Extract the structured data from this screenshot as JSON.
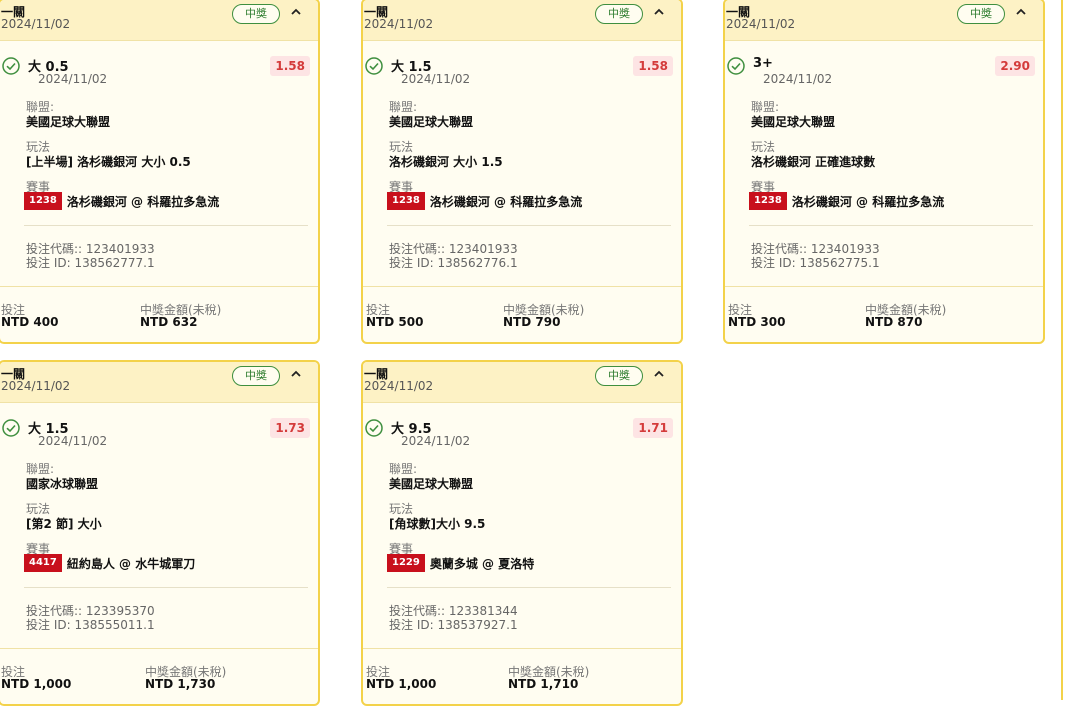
{
  "cards": [
    {
      "group": "一關",
      "group_date": "2024/11/02",
      "status": "中獎",
      "selection": "大 0.5",
      "selection_date": "2024/11/02",
      "odds": "1.58",
      "league_label": "聯盟:",
      "league": "美國足球大聯盟",
      "market_label": "玩法",
      "market": "[上半場] 洛杉磯銀河 大小 0.5",
      "event_label": "賽事",
      "event_code": "1238",
      "event_name": "洛杉磯銀河 @ 科羅拉多急流",
      "bet_code": "投注代碼:: 123401933",
      "bet_id": "投注 ID: 138562777.1",
      "stake_label": "投注",
      "stake": "NTD 400",
      "payout_label": "中獎金額(未稅)",
      "payout": "NTD 632"
    },
    {
      "group": "一關",
      "group_date": "2024/11/02",
      "status": "中獎",
      "selection": "大 1.5",
      "selection_date": "2024/11/02",
      "odds": "1.58",
      "league_label": "聯盟:",
      "league": "美國足球大聯盟",
      "market_label": "玩法",
      "market": "洛杉磯銀河 大小 1.5",
      "event_label": "賽事",
      "event_code": "1238",
      "event_name": "洛杉磯銀河 @ 科羅拉多急流",
      "bet_code": "投注代碼:: 123401933",
      "bet_id": "投注 ID: 138562776.1",
      "stake_label": "投注",
      "stake": "NTD 500",
      "payout_label": "中獎金額(未稅)",
      "payout": "NTD 790"
    },
    {
      "group": "一關",
      "group_date": "2024/11/02",
      "status": "中獎",
      "selection": "3+",
      "selection_date": "2024/11/02",
      "odds": "2.90",
      "league_label": "聯盟:",
      "league": "美國足球大聯盟",
      "market_label": "玩法",
      "market": "洛杉磯銀河 正確進球數",
      "event_label": "賽事",
      "event_code": "1238",
      "event_name": "洛杉磯銀河 @ 科羅拉多急流",
      "bet_code": "投注代碼:: 123401933",
      "bet_id": "投注 ID: 138562775.1",
      "stake_label": "投注",
      "stake": "NTD 300",
      "payout_label": "中獎金額(未稅)",
      "payout": "NTD 870"
    },
    {
      "group": "一關",
      "group_date": "2024/11/02",
      "status": "中獎",
      "selection": "大 1.5",
      "selection_date": "2024/11/02",
      "odds": "1.73",
      "league_label": "聯盟:",
      "league": "國家冰球聯盟",
      "market_label": "玩法",
      "market": "[第2 節] 大小",
      "event_label": "賽事",
      "event_code": "4417",
      "event_name": "紐約島人 @ 水牛城軍刀",
      "bet_code": "投注代碼:: 123395370",
      "bet_id": "投注 ID: 138555011.1",
      "stake_label": "投注",
      "stake": "NTD 1,000",
      "payout_label": "中獎金額(未稅)",
      "payout": "NTD 1,730"
    },
    {
      "group": "一關",
      "group_date": "2024/11/02",
      "status": "中獎",
      "selection": "大 9.5",
      "selection_date": "2024/11/02",
      "odds": "1.71",
      "league_label": "聯盟:",
      "league": "美國足球大聯盟",
      "market_label": "玩法",
      "market": "[角球數]大小 9.5",
      "event_label": "賽事",
      "event_code": "1229",
      "event_name": "奧蘭多城 @ 夏洛特",
      "bet_code": "投注代碼:: 123381344",
      "bet_id": "投注 ID: 138537927.1",
      "stake_label": "投注",
      "stake": "NTD 1,000",
      "payout_label": "中獎金額(未稅)",
      "payout": "NTD 1,710"
    }
  ],
  "colors": {
    "card_border": "#f3d24a",
    "header_bg": "#fdf2c5",
    "win_green": "#3f8f3f",
    "odds_red": "#d43b3b",
    "badge_red": "#c8101c"
  },
  "icons": {
    "status_icon": "check-circle-icon",
    "collapse_icon": "chevron-up-icon"
  }
}
